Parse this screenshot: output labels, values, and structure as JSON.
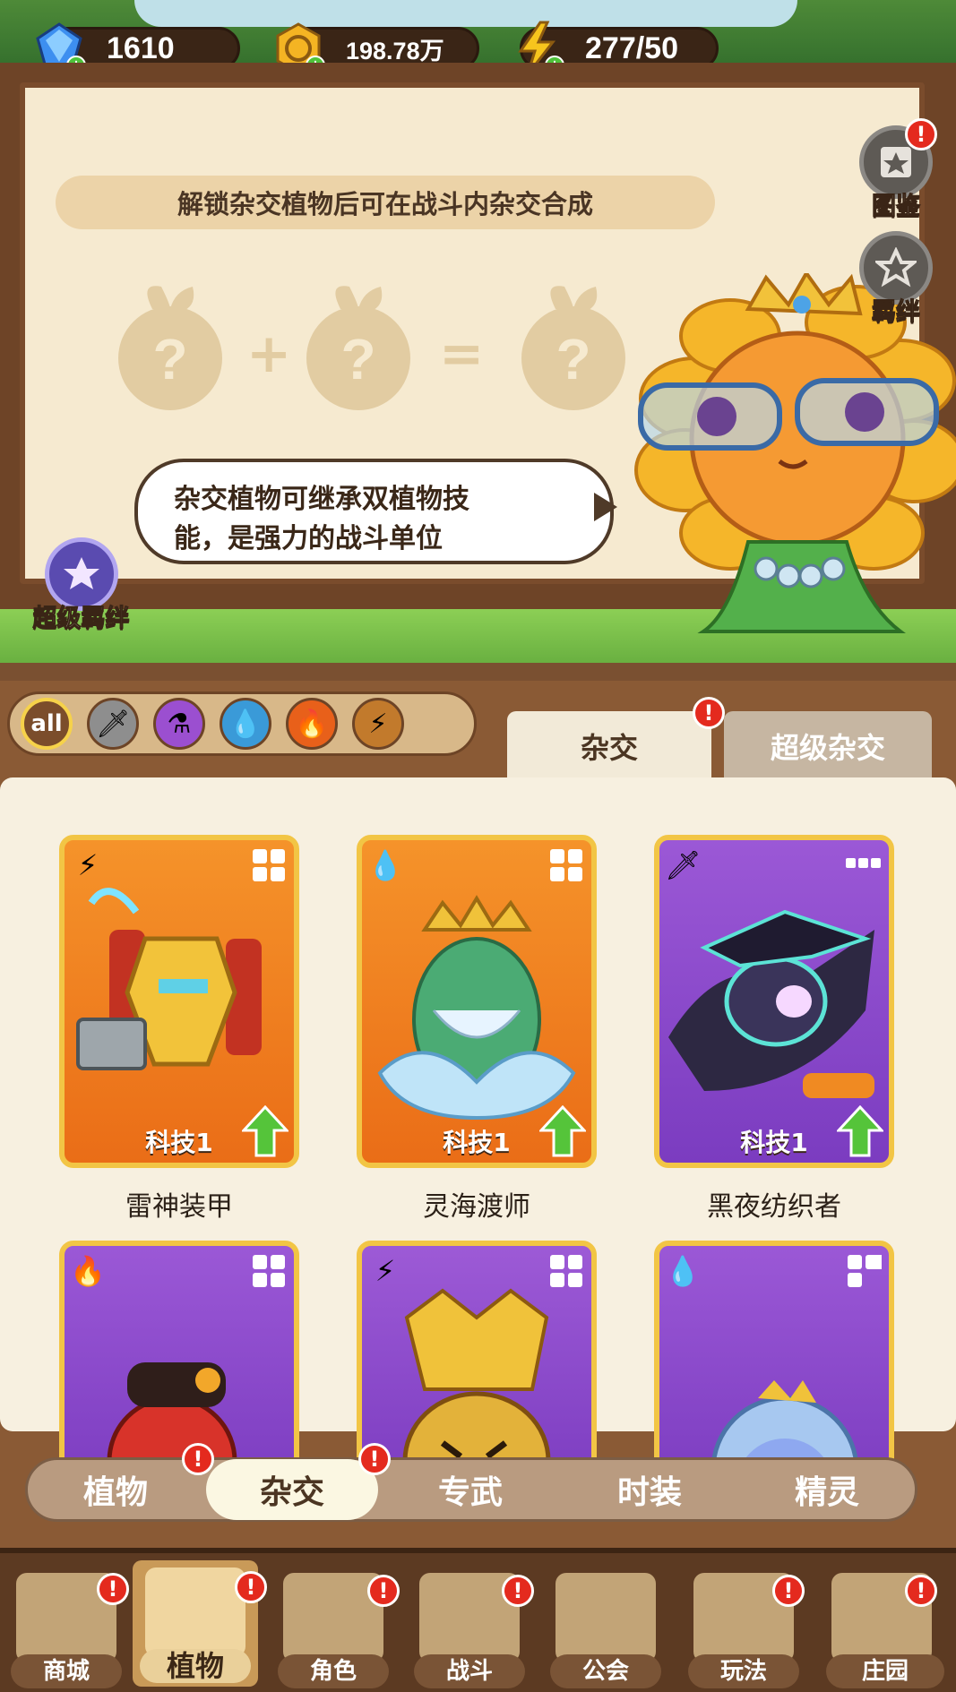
{
  "currency": {
    "gems": "1610",
    "coins": "198.78万",
    "energy": "277/50"
  },
  "board": {
    "banner": "解锁杂交植物后可在战斗内杂交合成",
    "bubble_line1": "杂交植物可继承双植物技",
    "bubble_line2": "能，是强力的战斗单位",
    "side_buttons": [
      {
        "label": "图鉴",
        "icon": "book-icon"
      },
      {
        "label": "羁绊",
        "icon": "bond-icon"
      }
    ],
    "super_bond": "超级羁绊"
  },
  "filters": [
    "all",
    "sword",
    "potion",
    "water",
    "fire",
    "lightning"
  ],
  "tabs": {
    "hybrid": "杂交",
    "super_hybrid": "超级杂交"
  },
  "cards": [
    {
      "name": "雷神装甲",
      "level": "科技1",
      "element": "lightning",
      "theme": "orange"
    },
    {
      "name": "灵海渡师",
      "level": "科技1",
      "element": "water",
      "theme": "orange"
    },
    {
      "name": "黑夜纺织者",
      "level": "科技1",
      "element": "sword",
      "theme": "purple"
    },
    {
      "name": "",
      "level": "",
      "element": "fire",
      "theme": "purple"
    },
    {
      "name": "",
      "level": "",
      "element": "lightning",
      "theme": "orange"
    },
    {
      "name": "",
      "level": "",
      "element": "water",
      "theme": "purple"
    }
  ],
  "subnav": [
    "植物",
    "杂交",
    "专武",
    "时装",
    "精灵"
  ],
  "nav": [
    "商城",
    "植物",
    "角色",
    "战斗",
    "公会",
    "玩法",
    "庄园"
  ],
  "badge": "!"
}
